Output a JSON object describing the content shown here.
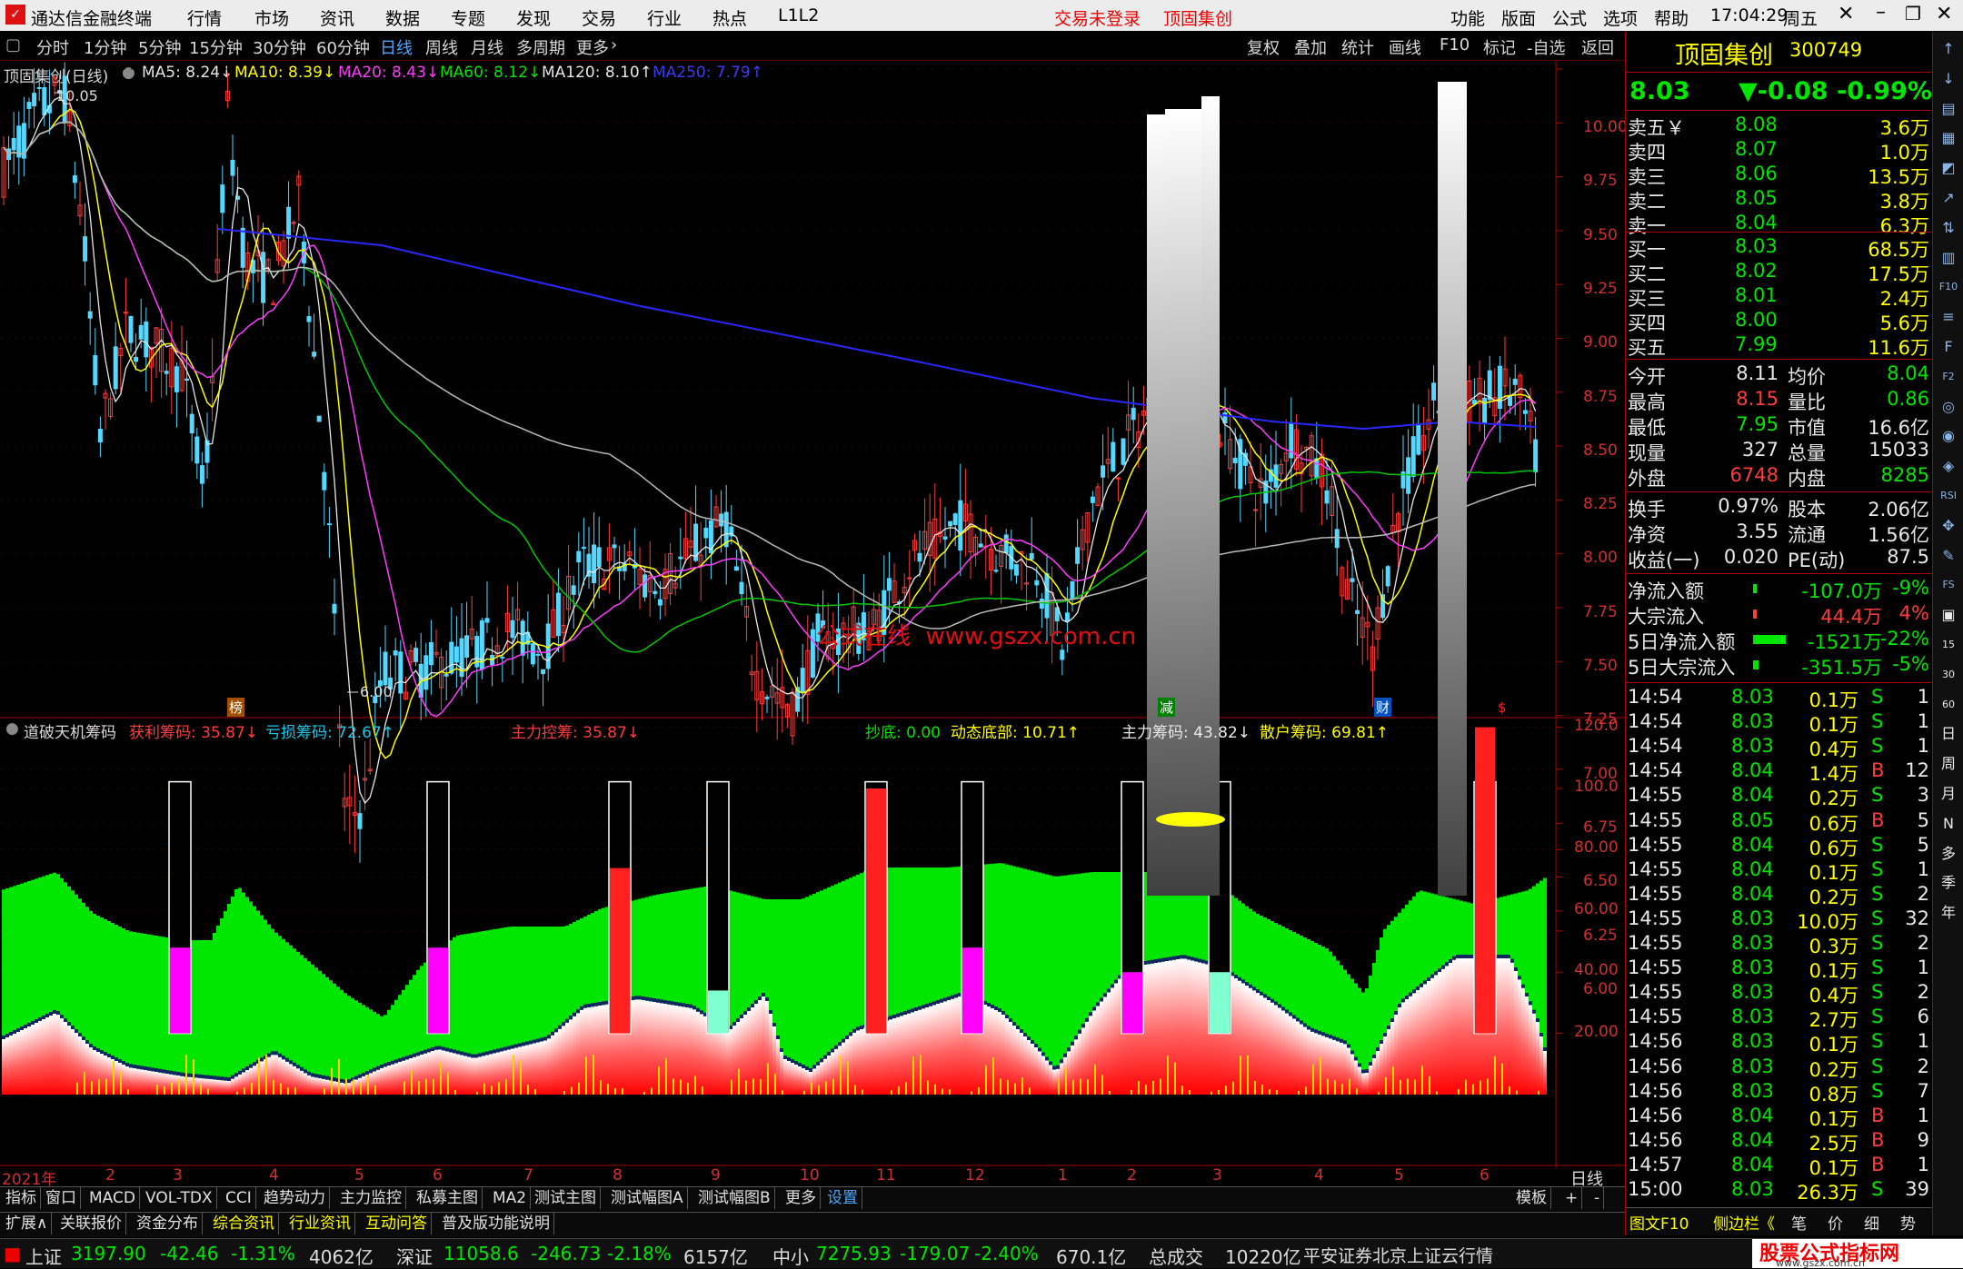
{
  "window": {
    "app_title": "通达信金融终端",
    "menus": [
      "行情",
      "市场",
      "资讯",
      "数据",
      "专题",
      "发现",
      "交易",
      "行业",
      "热点",
      "L1L2"
    ],
    "login_status": "交易未登录",
    "stock_name": "顶固集创",
    "right_menus": [
      "功能",
      "版面",
      "公式",
      "选项",
      "帮助"
    ],
    "time": "17:04:29",
    "weekday": "周五"
  },
  "periods": [
    "分时",
    "1分钟",
    "5分钟",
    "15分钟",
    "30分钟",
    "60分钟",
    "日线",
    "周线",
    "月线",
    "多周期",
    "更多"
  ],
  "active_period": "日线",
  "chart_tools": [
    "复权",
    "叠加",
    "统计",
    "画线",
    "F10",
    "标记",
    "-自选",
    "返回"
  ],
  "ma_line": {
    "title": "顶固集创(日线)",
    "items": [
      {
        "text": "MA5: 8.24↓",
        "color": "#e8e8e8"
      },
      {
        "text": "MA10: 8.39↓",
        "color": "#ffff00"
      },
      {
        "text": "MA20: 8.43↓",
        "color": "#ff3cff"
      },
      {
        "text": "MA60: 8.12↓",
        "color": "#00e600"
      },
      {
        "text": "MA120: 8.10↑",
        "color": "#e8e8e8"
      },
      {
        "text": "MA250: 7.79↑",
        "color": "#3c3cff"
      }
    ]
  },
  "main_chart": {
    "high_label": "10.05",
    "low_label": "6.00",
    "y_ticks": [
      "10.00",
      "9.75",
      "9.50",
      "9.25",
      "9.00",
      "8.75",
      "8.50",
      "8.25",
      "8.00",
      "7.75",
      "7.50",
      "7.25",
      "7.00",
      "6.75",
      "6.50",
      "6.25",
      "6.00"
    ],
    "watermark": "公式在线  www.gszx.com.cn",
    "markers": [
      "榜",
      "减",
      "财",
      "$"
    ]
  },
  "indicator": {
    "name": "道破天机筹码",
    "items": [
      {
        "text": "获利筹码: 35.87↓",
        "color": "#ff3c3c"
      },
      {
        "text": "亏损筹码: 72.67↑",
        "color": "#19c8e8"
      },
      {
        "text": "主力控筹: 35.87↓",
        "color": "#ff3c3c"
      },
      {
        "text": "抄底: 0.00",
        "color": "#00e600"
      },
      {
        "text": "动态底部: 10.71↑",
        "color": "#ffff00"
      },
      {
        "text": "主力筹码: 43.82↓",
        "color": "#e8e8e8"
      },
      {
        "text": "散户筹码: 69.81↑",
        "color": "#ffff00"
      }
    ],
    "y_ticks": [
      "120.0",
      "100.0",
      "80.00",
      "60.00",
      "40.00",
      "20.00"
    ]
  },
  "x_axis": [
    "2021年",
    "2",
    "3",
    "4",
    "5",
    "6",
    "7",
    "8",
    "9",
    "10",
    "11",
    "12",
    "1",
    "2",
    "3",
    "4",
    "5",
    "6"
  ],
  "x_axis_right": "日线",
  "bottom_tabs": [
    "指标",
    "窗口",
    "MACD",
    "VOL-TDX",
    "CCI",
    "趋势动力",
    "主力监控",
    "私募主图",
    "MA2",
    "测试主图",
    "测试幅图A",
    "测试幅图B",
    "更多",
    "设置"
  ],
  "bottom_tabs_right": [
    "模板",
    "+",
    "-"
  ],
  "info_tabs": [
    "扩展∧",
    "关联报价",
    "资金分布",
    "综合资讯",
    "行业资讯",
    "互动问答",
    "普及版功能说明"
  ],
  "right_panel": {
    "name": "顶固集创",
    "code": "300749",
    "price": "8.03",
    "change": "▼-0.08",
    "pct": "-0.99%",
    "asks": [
      {
        "label": "卖五￥",
        "price": "8.08",
        "vol": "3.6万"
      },
      {
        "label": "卖四",
        "price": "8.07",
        "vol": "1.0万"
      },
      {
        "label": "卖三",
        "price": "8.06",
        "vol": "13.5万"
      },
      {
        "label": "卖二",
        "price": "8.05",
        "vol": "3.8万"
      },
      {
        "label": "卖一",
        "price": "8.04",
        "vol": "6.3万"
      }
    ],
    "bids": [
      {
        "label": "买一",
        "price": "8.03",
        "vol": "68.5万"
      },
      {
        "label": "买二",
        "price": "8.02",
        "vol": "17.5万"
      },
      {
        "label": "买三",
        "price": "8.01",
        "vol": "2.4万"
      },
      {
        "label": "买四",
        "price": "8.00",
        "vol": "5.6万"
      },
      {
        "label": "买五",
        "price": "7.99",
        "vol": "11.6万"
      }
    ],
    "stats": [
      {
        "l1": "今开",
        "v1": "8.11",
        "c1": "#e8e8e8",
        "l2": "均价",
        "v2": "8.04",
        "c2": "#00e600"
      },
      {
        "l1": "最高",
        "v1": "8.15",
        "c1": "#ff3c3c",
        "l2": "量比",
        "v2": "0.86",
        "c2": "#00e600"
      },
      {
        "l1": "最低",
        "v1": "7.95",
        "c1": "#00e600",
        "l2": "市值",
        "v2": "16.6亿",
        "c2": "#e8e8e8"
      },
      {
        "l1": "现量",
        "v1": "327",
        "c1": "#e8e8e8",
        "l2": "总量",
        "v2": "15033",
        "c2": "#e8e8e8"
      },
      {
        "l1": "外盘",
        "v1": "6748",
        "c1": "#ff3c3c",
        "l2": "内盘",
        "v2": "8285",
        "c2": "#00e600"
      }
    ],
    "stats2": [
      {
        "l1": "换手",
        "v1": "0.97%",
        "l2": "股本",
        "v2": "2.06亿"
      },
      {
        "l1": "净资",
        "v1": "3.55",
        "l2": "流通",
        "v2": "1.56亿"
      },
      {
        "l1": "收益(一)",
        "v1": "0.020",
        "l2": "PE(动)",
        "v2": "87.5"
      }
    ],
    "flows": [
      {
        "label": "净流入额",
        "val": "-107.0万",
        "pct": "-9%",
        "color": "#00e600"
      },
      {
        "label": "大宗流入",
        "val": "44.4万",
        "pct": "4%",
        "color": "#ff3c3c"
      },
      {
        "label": "5日净流入额",
        "val": "-1521万",
        "pct": "-22%",
        "color": "#00e600"
      },
      {
        "label": "5日大宗流入",
        "val": "-351.5万",
        "pct": "-5%",
        "color": "#00e600"
      }
    ],
    "ticks": [
      {
        "t": "14:54",
        "p": "8.03",
        "v": "0.1万",
        "s": "S",
        "n": "1"
      },
      {
        "t": "14:54",
        "p": "8.03",
        "v": "0.1万",
        "s": "S",
        "n": "1"
      },
      {
        "t": "14:54",
        "p": "8.03",
        "v": "0.4万",
        "s": "S",
        "n": "1"
      },
      {
        "t": "14:54",
        "p": "8.04",
        "v": "1.4万",
        "s": "B",
        "n": "12"
      },
      {
        "t": "14:55",
        "p": "8.04",
        "v": "0.2万",
        "s": "S",
        "n": "3"
      },
      {
        "t": "14:55",
        "p": "8.05",
        "v": "0.6万",
        "s": "B",
        "n": "5"
      },
      {
        "t": "14:55",
        "p": "8.04",
        "v": "0.6万",
        "s": "S",
        "n": "5"
      },
      {
        "t": "14:55",
        "p": "8.04",
        "v": "0.1万",
        "s": "S",
        "n": "1"
      },
      {
        "t": "14:55",
        "p": "8.04",
        "v": "0.2万",
        "s": "S",
        "n": "2"
      },
      {
        "t": "14:55",
        "p": "8.03",
        "v": "10.0万",
        "s": "S",
        "n": "32"
      },
      {
        "t": "14:55",
        "p": "8.03",
        "v": "0.3万",
        "s": "S",
        "n": "2"
      },
      {
        "t": "14:55",
        "p": "8.03",
        "v": "0.1万",
        "s": "S",
        "n": "1"
      },
      {
        "t": "14:55",
        "p": "8.03",
        "v": "0.4万",
        "s": "S",
        "n": "2"
      },
      {
        "t": "14:55",
        "p": "8.03",
        "v": "2.7万",
        "s": "S",
        "n": "6"
      },
      {
        "t": "14:56",
        "p": "8.03",
        "v": "0.1万",
        "s": "S",
        "n": "1"
      },
      {
        "t": "14:56",
        "p": "8.03",
        "v": "0.2万",
        "s": "S",
        "n": "2"
      },
      {
        "t": "14:56",
        "p": "8.03",
        "v": "0.8万",
        "s": "S",
        "n": "7"
      },
      {
        "t": "14:56",
        "p": "8.04",
        "v": "0.1万",
        "s": "B",
        "n": "1"
      },
      {
        "t": "14:56",
        "p": "8.04",
        "v": "2.5万",
        "s": "B",
        "n": "9"
      },
      {
        "t": "14:57",
        "p": "8.04",
        "v": "0.1万",
        "s": "B",
        "n": "1"
      },
      {
        "t": "15:00",
        "p": "8.03",
        "v": "26.3万",
        "s": "S",
        "n": "39"
      }
    ],
    "bottom_tabs": [
      "图文F10",
      "侧边栏《",
      "笔",
      "价",
      "细",
      "势"
    ]
  },
  "icon_strip": [
    "↑",
    "↓",
    "▤",
    "▦",
    "◩",
    "↗",
    "⇅",
    "▥",
    "F10",
    "≡",
    "F",
    "F2",
    "◎",
    "◉",
    "◈",
    "RSI",
    "✥",
    "✎",
    "FS",
    "▣",
    "15",
    "30",
    "60",
    "日",
    "周",
    "月",
    "N",
    "多",
    "季",
    "年"
  ],
  "status": {
    "sh_name": "上证",
    "sh_val": "3197.90",
    "sh_chg": "-42.46",
    "sh_pct": "-1.31%",
    "sh_amt": "4062亿",
    "sz_name": "深证",
    "sz_val": "11058.6",
    "sz_chg": "-246.73",
    "sz_pct": "-2.18%",
    "sz_amt": "6157亿",
    "zx_name": "中小",
    "zx_val": "7275.93",
    "zx_chg": "-179.07",
    "zx_pct": "-2.40%",
    "zx_amt": "670.1亿",
    "total_label": "总成交",
    "total_val": "10220亿",
    "server": "平安证券北京上证云行情",
    "logo": "股票公式指标网",
    "logo_url": "www.gszx.com.cn"
  }
}
